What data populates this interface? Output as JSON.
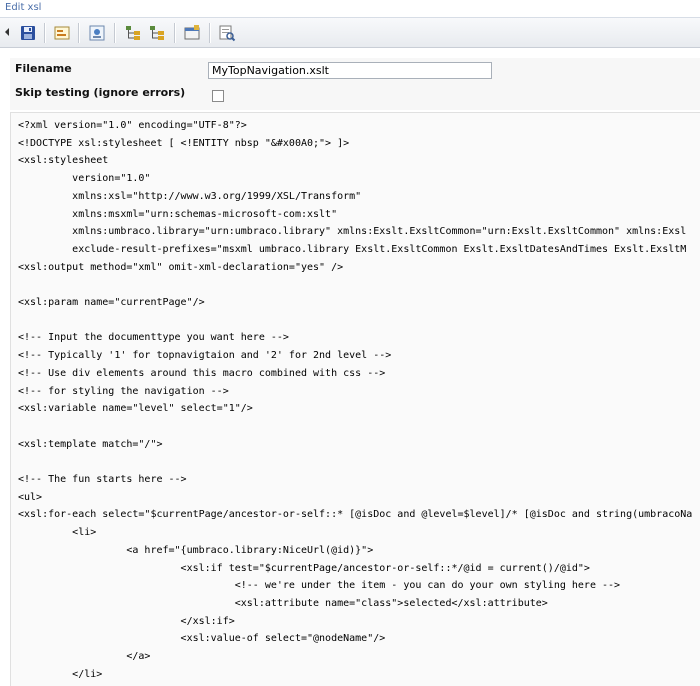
{
  "header": {
    "title": "Edit xsl"
  },
  "toolbar": {
    "buttons": [
      {
        "name": "save-icon"
      },
      {
        "name": "insert-xslt-value-icon"
      },
      {
        "name": "insert-umbraco-field-icon"
      },
      {
        "name": "insert-choose-icon"
      },
      {
        "name": "insert-if-icon"
      },
      {
        "name": "insert-variable-icon"
      },
      {
        "name": "preview-icon"
      }
    ]
  },
  "props": {
    "filename_label": "Filename",
    "filename_value": "MyTopNavigation.xslt",
    "skip_label": "Skip testing (ignore errors)",
    "skip_checked": false
  },
  "editor": {
    "lines": [
      "<?xml version=\"1.0\" encoding=\"UTF-8\"?>",
      "<!DOCTYPE xsl:stylesheet [ <!ENTITY nbsp \"&#x00A0;\"> ]>",
      "<xsl:stylesheet",
      "         version=\"1.0\"",
      "         xmlns:xsl=\"http://www.w3.org/1999/XSL/Transform\"",
      "         xmlns:msxml=\"urn:schemas-microsoft-com:xslt\"",
      "         xmlns:umbraco.library=\"urn:umbraco.library\" xmlns:Exslt.ExsltCommon=\"urn:Exslt.ExsltCommon\" xmlns:Exsl",
      "         exclude-result-prefixes=\"msxml umbraco.library Exslt.ExsltCommon Exslt.ExsltDatesAndTimes Exslt.ExsltM",
      "<xsl:output method=\"xml\" omit-xml-declaration=\"yes\" />",
      "",
      "<xsl:param name=\"currentPage\"/>",
      "",
      "<!-- Input the documenttype you want here -->",
      "<!-- Typically '1' for topnavigtaion and '2' for 2nd level -->",
      "<!-- Use div elements around this macro combined with css -->",
      "<!-- for styling the navigation -->",
      "<xsl:variable name=\"level\" select=\"1\"/>",
      "",
      "<xsl:template match=\"/\">",
      "",
      "<!-- The fun starts here -->",
      "<ul>",
      "<xsl:for-each select=\"$currentPage/ancestor-or-self::* [@isDoc and @level=$level]/* [@isDoc and string(umbracoNa",
      "         <li>",
      "                  <a href=\"{umbraco.library:NiceUrl(@id)}\">",
      "                           <xsl:if test=\"$currentPage/ancestor-or-self::*/@id = current()/@id\">",
      "                                    <!-- we're under the item - you can do your own styling here -->",
      "                                    <xsl:attribute name=\"class\">selected</xsl:attribute>",
      "                           </xsl:if>",
      "                           <xsl:value-of select=\"@nodeName\"/>",
      "                  </a>",
      "         </li>"
    ]
  }
}
